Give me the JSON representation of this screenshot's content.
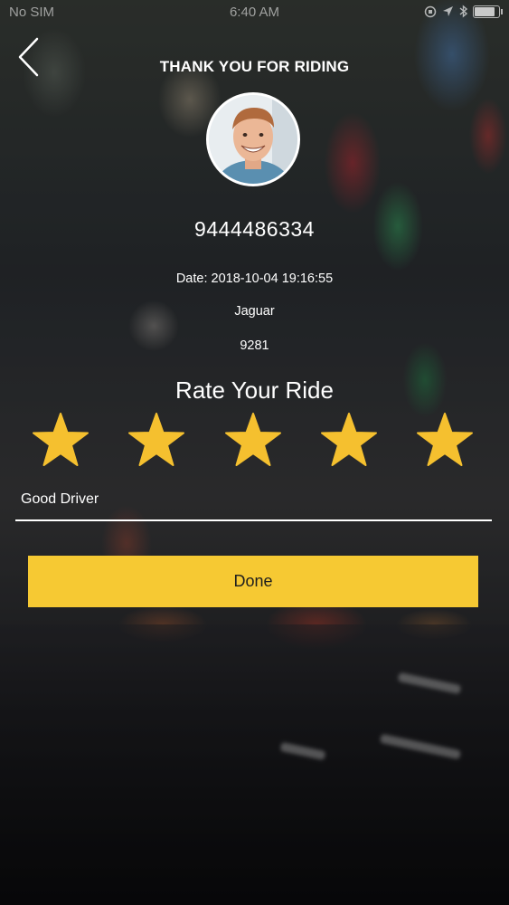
{
  "status_bar": {
    "carrier": "No SIM",
    "time": "6:40 AM",
    "battery_level": 0.9
  },
  "header": {
    "back_icon": "chevron-left-icon",
    "title": "THANK YOU FOR RIDING"
  },
  "driver": {
    "avatar_icon": "driver-avatar",
    "phone": "9444486334"
  },
  "trip": {
    "date": "Date: 2018-10-04 19:16:55",
    "car_model": "Jaguar",
    "car_number": "9281"
  },
  "rating": {
    "title": "Rate Your Ride",
    "value": 5,
    "max": 5,
    "star_color": "#f5c02f"
  },
  "comment": {
    "value": "Good Driver"
  },
  "actions": {
    "done_label": "Done",
    "done_color": "#f6c933"
  }
}
